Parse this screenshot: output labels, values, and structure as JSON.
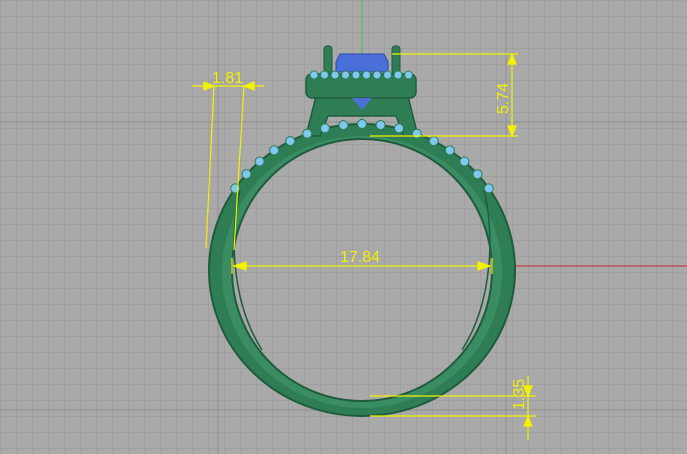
{
  "viewport": {
    "background": "#a9a9a9",
    "grid_color": "#989898",
    "major_grid_color": "#8c8c8c",
    "axis_y_color": "#3fbf3f",
    "axis_x_color": "#c62828"
  },
  "model": {
    "band_color": "#2e7d55",
    "band_highlight": "#3f9a6d",
    "stone_color": "#4a6fd8",
    "accent_stone_color": "#7fc8f0"
  },
  "dimensions": {
    "color": "#f2f200",
    "inner_diameter": "17.84",
    "shoulder_width": "1.81",
    "head_height": "5.74",
    "band_thickness": "1.35"
  }
}
